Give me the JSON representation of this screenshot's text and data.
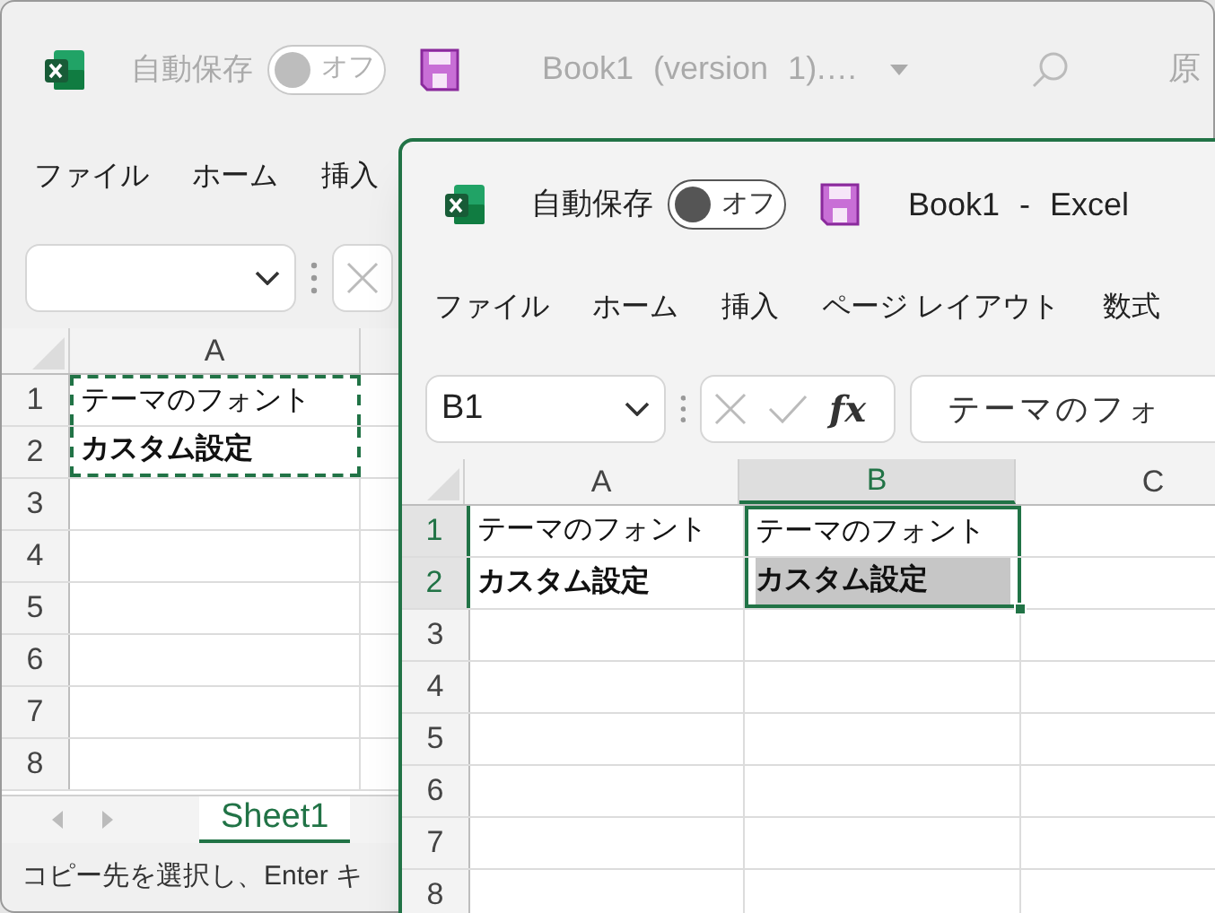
{
  "windows": [
    {
      "active": false,
      "autosave_label": "自動保存",
      "autosave_toggle": {
        "on": false,
        "label": "オフ"
      },
      "title": "Book1 (version 1).…",
      "user": "原",
      "menu": [
        "ファイル",
        "ホーム",
        "挿入"
      ],
      "columns": [
        {
          "label": "A",
          "selected": false
        }
      ],
      "rows": [
        {
          "label": "1",
          "selected": false,
          "cells": [
            {
              "text": "テーマのフォント",
              "bold": false,
              "selected": false,
              "copied": true
            }
          ]
        },
        {
          "label": "2",
          "selected": false,
          "cells": [
            {
              "text": "カスタム設定",
              "bold": true,
              "selected": false,
              "copied": true
            }
          ]
        },
        {
          "label": "3",
          "selected": false
        },
        {
          "label": "4",
          "selected": false
        },
        {
          "label": "5",
          "selected": false
        },
        {
          "label": "6",
          "selected": false
        },
        {
          "label": "7",
          "selected": false
        },
        {
          "label": "8",
          "selected": false
        }
      ],
      "sheet_tabs": [
        {
          "label": "Sheet1",
          "selected": true
        }
      ],
      "status": "コピー先を選択し、Enter キ"
    },
    {
      "active": true,
      "autosave_label": "自動保存",
      "autosave_toggle": {
        "on": false,
        "label": "オフ"
      },
      "title": "Book1 - Excel",
      "menu": [
        "ファイル",
        "ホーム",
        "挿入",
        "ページ レイアウト",
        "数式"
      ],
      "name_box": "B1",
      "fx": "fx",
      "formula": "テーマのフォ",
      "columns": [
        {
          "label": "A",
          "selected": false
        },
        {
          "label": "B",
          "selected": true
        },
        {
          "label": "C",
          "selected": false
        }
      ],
      "rows": [
        {
          "label": "1",
          "selected": true,
          "cells": [
            {
              "text": "テーマのフォント",
              "bold": false,
              "selected": false,
              "copied": false
            },
            {
              "text": "テーマのフォント",
              "bold": false,
              "selected": true,
              "copied": false
            }
          ]
        },
        {
          "label": "2",
          "selected": true,
          "cells": [
            {
              "text": "カスタム設定",
              "bold": true,
              "selected": false,
              "copied": false
            },
            {
              "text": "カスタム設定",
              "bold": true,
              "selected": true,
              "shaded": true,
              "copied": false
            }
          ]
        },
        {
          "label": "3",
          "selected": false
        },
        {
          "label": "4",
          "selected": false
        },
        {
          "label": "5",
          "selected": false
        },
        {
          "label": "6",
          "selected": false
        },
        {
          "label": "7",
          "selected": false
        },
        {
          "label": "8",
          "selected": false
        }
      ]
    }
  ]
}
